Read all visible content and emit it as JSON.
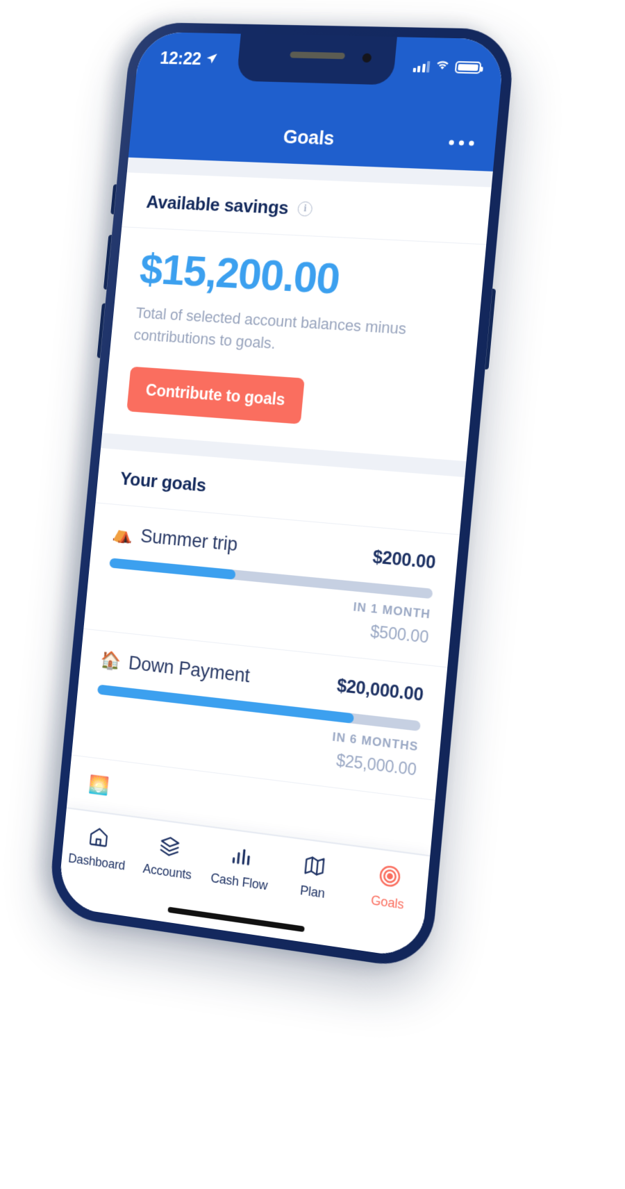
{
  "theme": {
    "brand_blue": "#1f5fcd",
    "accent_blue": "#3ca0ef",
    "coral": "#fa6e5f",
    "navy": "#13295c",
    "muted": "#9aa8c4",
    "track": "#c6d0e2",
    "phone_frame": "#142a63"
  },
  "status_bar": {
    "time": "12:22",
    "location_icon": "location-arrow-icon",
    "signal_icon": "cellular-signal-icon",
    "wifi_icon": "wifi-icon",
    "battery_icon": "battery-full-icon"
  },
  "nav": {
    "title": "Goals",
    "more_icon": "ellipsis-icon"
  },
  "available_savings": {
    "heading": "Available savings",
    "info_icon": "info-circle-icon",
    "info_glyph": "i",
    "amount": "$15,200.00",
    "description": "Total of selected account balances minus contributions to goals.",
    "cta_label": "Contribute to goals"
  },
  "your_goals": {
    "heading": "Your goals",
    "items": [
      {
        "emoji": "⛺",
        "emoji_name": "tent-emoji",
        "name": "Summer trip",
        "saved": "$200.00",
        "eta": "IN 1 MONTH",
        "target": "$500.00",
        "progress_pct": 40
      },
      {
        "emoji": "🏠",
        "emoji_name": "house-emoji",
        "name": "Down Payment",
        "saved": "$20,000.00",
        "eta": "IN 6 MONTHS",
        "target": "$25,000.00",
        "progress_pct": 80
      },
      {
        "emoji": "🌅",
        "emoji_name": "partial-goal-emoji",
        "name": "",
        "saved": "",
        "eta": "",
        "target": "",
        "progress_pct": 0
      }
    ]
  },
  "tab_bar": {
    "items": [
      {
        "label": "Dashboard",
        "icon": "home-icon",
        "active": false
      },
      {
        "label": "Accounts",
        "icon": "layers-icon",
        "active": false
      },
      {
        "label": "Cash Flow",
        "icon": "bar-chart-icon",
        "active": false
      },
      {
        "label": "Plan",
        "icon": "map-icon",
        "active": false
      },
      {
        "label": "Goals",
        "icon": "target-icon",
        "active": true
      }
    ]
  }
}
